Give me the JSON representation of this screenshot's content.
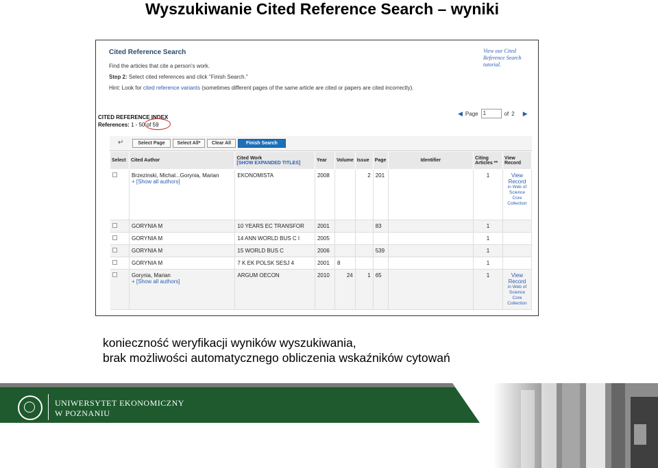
{
  "slide": {
    "title": "Wyszukiwanie Cited Reference Search – wyniki",
    "caption_line1": "konieczność weryfikacji wyników wyszukiwania,",
    "caption_line2": "brak możliwości automatycznego obliczenia wskaźników cytowań"
  },
  "header": {
    "title": "Cited Reference Search",
    "line1": "Find the articles that cite a person's work.",
    "step_label": "Step 2:",
    "step_text": "Select cited references and click \"Finish Search.\"",
    "hint_prefix": "Hint: Look for",
    "hint_link": "cited reference variants",
    "hint_suffix": "(sometimes different pages of the same article are cited or papers are cited incorrectly).",
    "tutorial": "View our Cited Reference Search tutorial."
  },
  "index": {
    "title": "CITED REFERENCE INDEX",
    "refs_label": "References:",
    "refs_range": "1 - 50 of 59"
  },
  "pager": {
    "label": "Page",
    "value": "1",
    "of": "of",
    "total": "2"
  },
  "buttons": {
    "select_page": "Select Page",
    "select_all": "Select All*",
    "clear_all": "Clear All",
    "finish": "Finish Search"
  },
  "table": {
    "headers": {
      "select": "Select",
      "author": "Cited Author",
      "work": "Cited Work",
      "work_sub": "[SHOW EXPANDED TITLES]",
      "year": "Year",
      "volume": "Volume",
      "issue": "Issue",
      "page": "Page",
      "identifier": "Identifier",
      "citing": "Citing Articles **",
      "view": "View Record"
    },
    "show_all": "[Show all authors]",
    "view_link": "View Record",
    "view_sub": "in Web of Science Core Collection",
    "rows": [
      {
        "author": "Brzezinski, Michal...Gorynia, Marian",
        "work": "EKONOMISTA",
        "year": "2008",
        "volume": "",
        "issue": "2",
        "page": "201",
        "citing": "1"
      },
      {
        "author": "GORYNIA M",
        "work": "10 YEARS EC TRANSFOR",
        "year": "2001",
        "volume": "",
        "issue": "",
        "page": "83",
        "citing": "1"
      },
      {
        "author": "GORYNIA M",
        "work": "14 ANN WORLD BUS C I",
        "year": "2005",
        "volume": "",
        "issue": "",
        "page": "",
        "citing": "1"
      },
      {
        "author": "GORYNIA M",
        "work": "15 WORLD BUS C",
        "year": "2006",
        "volume": "",
        "issue": "",
        "page": "539",
        "citing": "1"
      },
      {
        "author": "GORYNIA M",
        "work": "7 K EK POLSK SESJ 4",
        "year": "2001",
        "volume": "8",
        "issue": "",
        "page": "",
        "citing": "1"
      },
      {
        "author": "Gorynia, Marian",
        "work": "ARGUM OECON",
        "year": "2010",
        "volume": "24",
        "issue": "1",
        "page": "65",
        "citing": "1"
      }
    ]
  },
  "footer": {
    "university_line1": "UNIWERSYTET EKONOMICZNY",
    "university_line2": "W POZNANIU"
  },
  "colors": {
    "brand_green": "#1e5a2e",
    "accent_red": "#c62828",
    "link_blue": "#2a5db0"
  }
}
